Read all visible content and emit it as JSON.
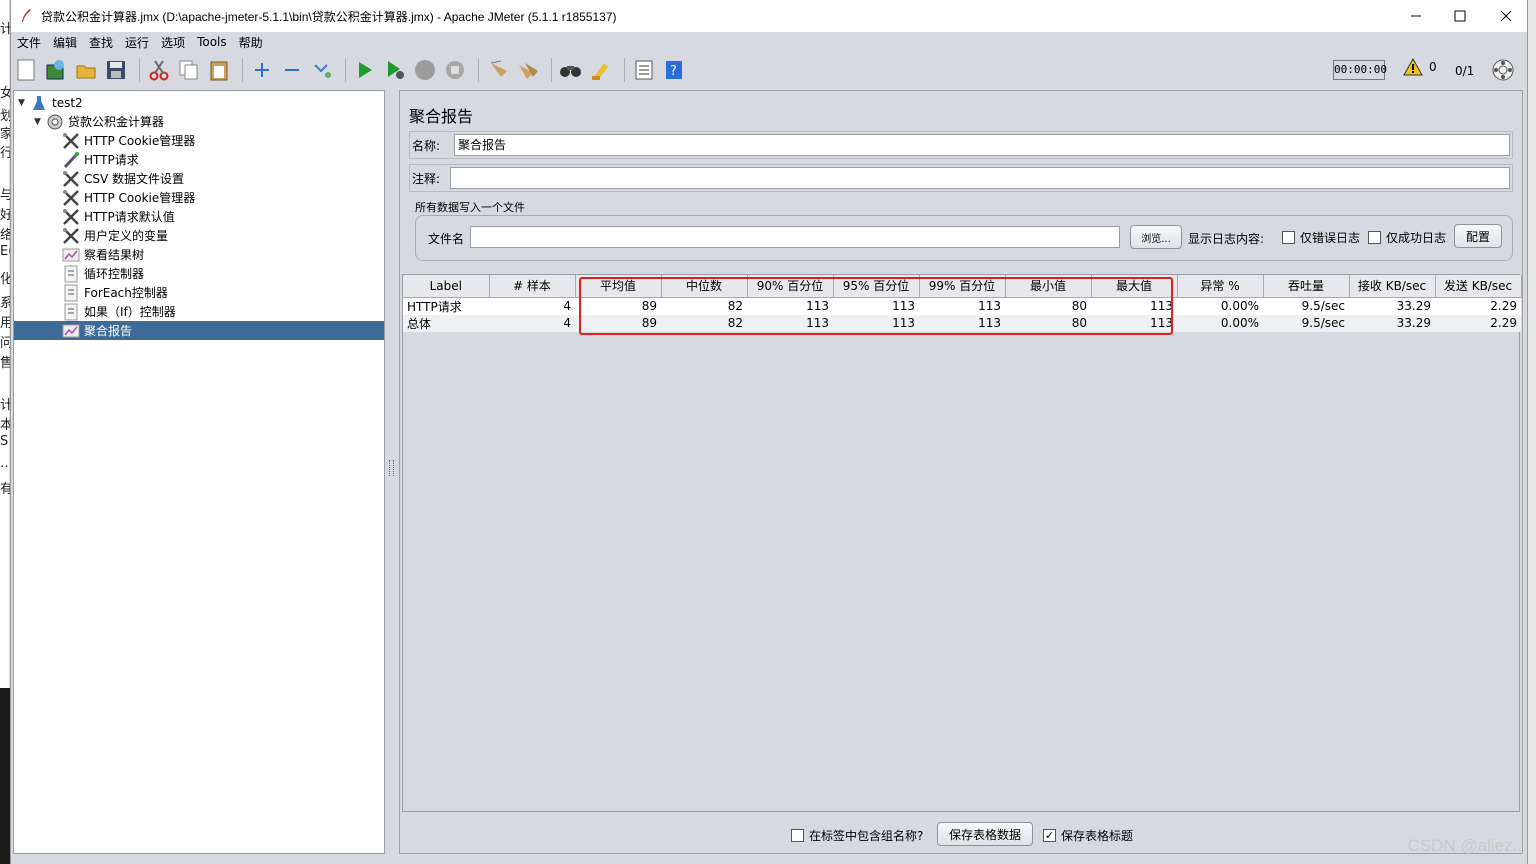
{
  "background": {
    "left_chars": [
      "计",
      "女",
      "划",
      "家",
      "行",
      "与",
      "好",
      "络",
      "E(",
      "化",
      "系",
      "用",
      "问",
      "售",
      "计",
      "本",
      "S",
      "…",
      "有"
    ],
    "watermark": "CSDN @aliez.."
  },
  "window": {
    "title": "贷款公积金计算器.jmx (D:\\apache-jmeter-5.1.1\\bin\\贷款公积金计算器.jmx) - Apache JMeter (5.1.1 r1855137)",
    "minimize": "—",
    "maximize": "☐",
    "close": "✕"
  },
  "menu": [
    "文件",
    "编辑",
    "查找",
    "运行",
    "选项",
    "Tools",
    "帮助"
  ],
  "toolbar": {
    "timer": "00:00:00",
    "warning_count": "0",
    "threads": "0/1"
  },
  "tree": {
    "items": [
      {
        "label": "test2",
        "icon": "test-plan-icon"
      },
      {
        "label": "贷款公积金计算器",
        "icon": "thread-group-icon"
      },
      {
        "label": "HTTP Cookie管理器",
        "icon": "config-element-icon"
      },
      {
        "label": "HTTP请求",
        "icon": "sampler-icon"
      },
      {
        "label": "CSV 数据文件设置",
        "icon": "config-element-icon"
      },
      {
        "label": "HTTP Cookie管理器",
        "icon": "config-element-icon"
      },
      {
        "label": "HTTP请求默认值",
        "icon": "config-element-icon"
      },
      {
        "label": "用户定义的变量",
        "icon": "config-element-icon"
      },
      {
        "label": "察看结果树",
        "icon": "listener-icon"
      },
      {
        "label": "循环控制器",
        "icon": "controller-icon"
      },
      {
        "label": "ForEach控制器",
        "icon": "controller-icon"
      },
      {
        "label": "如果（If）控制器",
        "icon": "controller-icon"
      },
      {
        "label": "聚合报告",
        "icon": "listener-icon"
      }
    ]
  },
  "panel": {
    "title": "聚合报告",
    "name_label": "名称:",
    "name_value": "聚合报告",
    "comment_label": "注释:",
    "comment_value": "",
    "file_section_title": "所有数据写入一个文件",
    "file_label": "文件名",
    "file_value": "",
    "browse_button": "浏览...",
    "log_label": "显示日志内容:",
    "errors_only": "仅错误日志",
    "success_only": "仅成功日志",
    "configure_button": "配置"
  },
  "table": {
    "headers": [
      "Label",
      "# 样本",
      "平均值",
      "中位数",
      "90% 百分位",
      "95% 百分位",
      "99% 百分位",
      "最小值",
      "最大值",
      "异常 %",
      "吞吐量",
      "接收 KB/sec",
      "发送 KB/sec"
    ],
    "rows": [
      [
        "HTTP请求",
        "4",
        "89",
        "82",
        "113",
        "113",
        "113",
        "80",
        "113",
        "0.00%",
        "9.5/sec",
        "33.29",
        "2.29"
      ],
      [
        "总体",
        "4",
        "89",
        "82",
        "113",
        "113",
        "113",
        "80",
        "113",
        "0.00%",
        "9.5/sec",
        "33.29",
        "2.29"
      ]
    ]
  },
  "bottom": {
    "include_group_name": "在标签中包含组名称?",
    "save_table_data": "保存表格数据",
    "save_table_header": "保存表格标题",
    "save_header_checked": true
  }
}
